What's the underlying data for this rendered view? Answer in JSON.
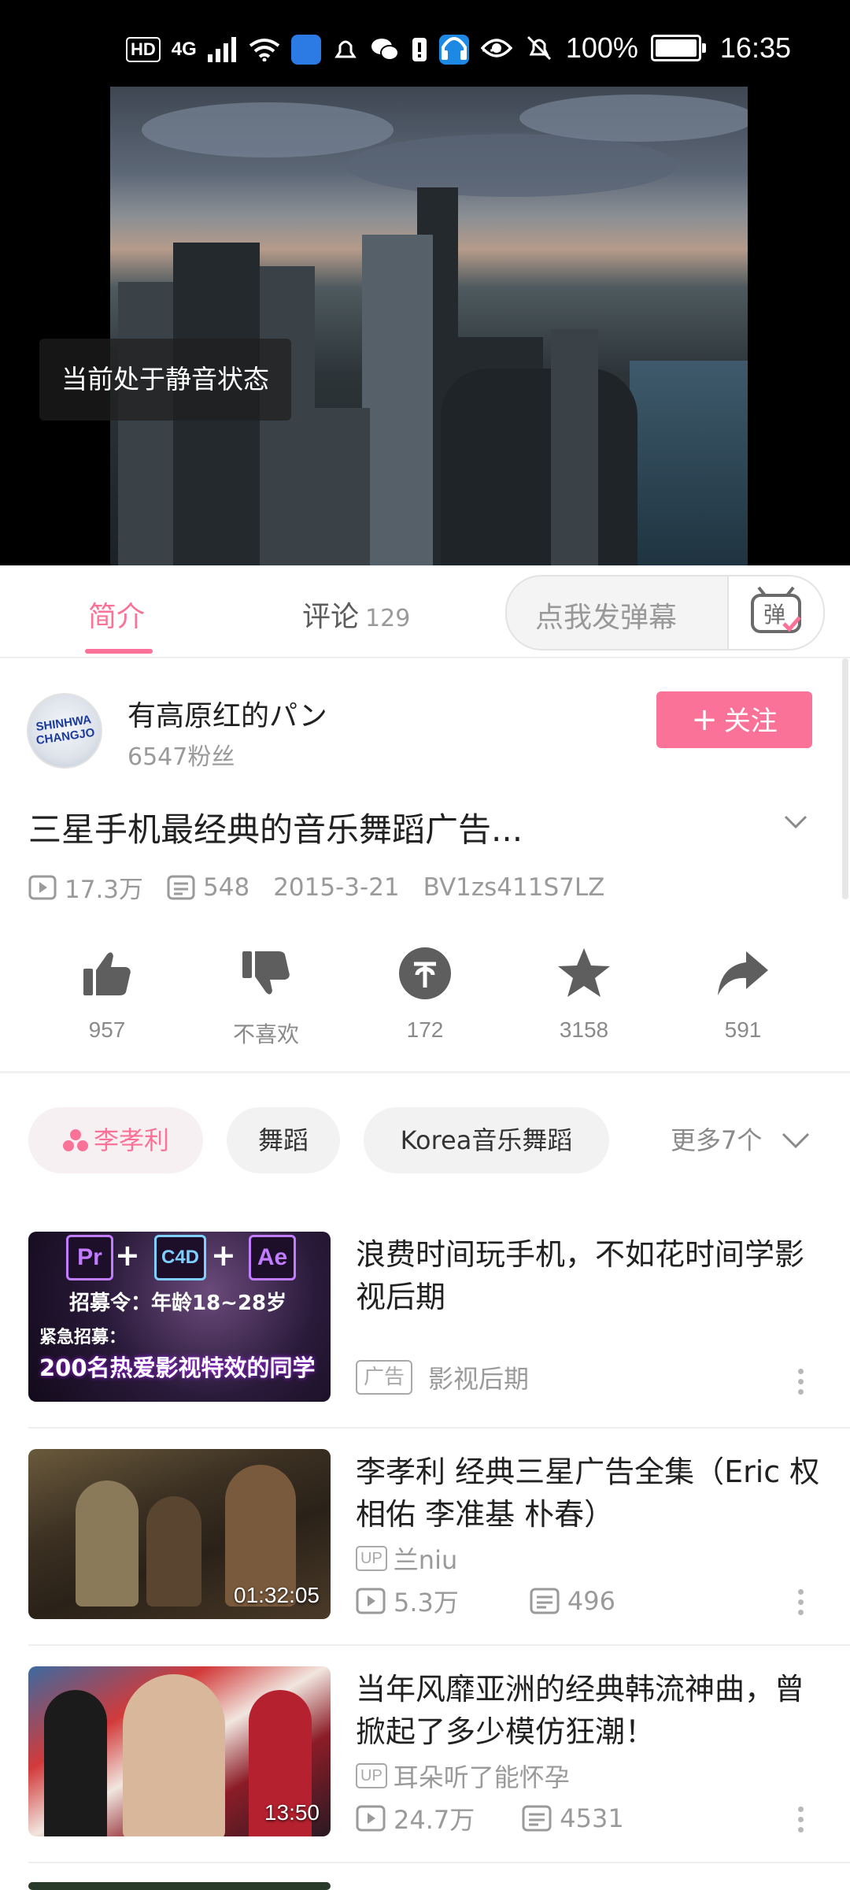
{
  "status_bar": {
    "left_chips": [
      "HD",
      "4G"
    ],
    "battery_percent": "100%",
    "time": "16:35",
    "more_glyph": "···"
  },
  "player": {
    "mute_toast": "当前处于静音状态"
  },
  "tabs": {
    "intro_label": "简介",
    "comments_label": "评论",
    "comments_count": "129",
    "danmaku_placeholder": "点我发弹幕",
    "danmaku_icon_glyph": "弹"
  },
  "uploader": {
    "avatar_text": "SHINHWA CHANGJO",
    "name": "有高原红的パン",
    "fans": "6547粉丝",
    "follow_label": "关注"
  },
  "video": {
    "title": "三星手机最经典的音乐舞蹈广告...",
    "views": "17.3万",
    "danmaku_count": "548",
    "date": "2015-3-21",
    "bvid": "BV1zs411S7LZ"
  },
  "actions": {
    "like": "957",
    "dislike": "不喜欢",
    "coin": "172",
    "favorite": "3158",
    "share": "591"
  },
  "tags": {
    "items": [
      "李孝利",
      "舞蹈",
      "Korea音乐舞蹈"
    ],
    "more": "更多7个"
  },
  "related": [
    {
      "type": "ad",
      "title": "浪费时间玩手机，不如花时间学影视后期",
      "ad_badge": "广告",
      "source": "影视后期",
      "thumb_logos": [
        "Pr",
        "C4D",
        "Ae"
      ],
      "thumb_line1": "招募令：年龄18~28岁",
      "thumb_line2": "紧急招募：",
      "thumb_line3": "200名热爱影视特效的同学"
    },
    {
      "type": "video",
      "title": "李孝利 经典三星广告全集（Eric 权相佑 李准基 朴春）",
      "up": "兰niu",
      "views": "5.3万",
      "danmaku": "496",
      "duration": "01:32:05"
    },
    {
      "type": "video",
      "title": "当年风靡亚洲的经典韩流神曲，曾掀起了多少模仿狂潮！",
      "up": "耳朵听了能怀孕",
      "views": "24.7万",
      "danmaku": "4531",
      "duration": "13:50"
    }
  ],
  "labels": {
    "up_badge": "UP"
  },
  "colors": {
    "accent": "#fb7299",
    "text": "#212121",
    "muted": "#9a9a9a"
  }
}
